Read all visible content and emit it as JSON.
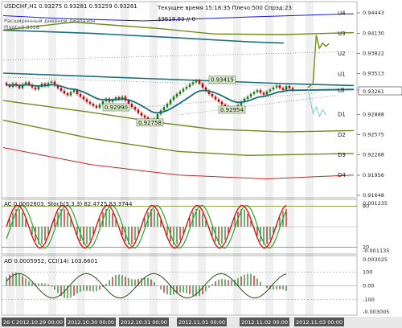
{
  "header": {
    "symbol_line": "USDCHF,H1  0.93275 0.93281 0.93259 0.93261",
    "subtitle_1": "Расширенный дневной диапазон",
    "subtitle_2": "Pivot=0.9318",
    "status": "Текущее время 15:18:35 Плечо:500 Спрэд:23",
    "balance": "$9618.93  // 0"
  },
  "price_axis": {
    "labels": [
      "0.94443",
      "0.94130",
      "0.93822",
      "0.93513",
      "0.93261",
      "0.92888",
      "0.92575",
      "0.92268",
      "0.91956",
      "0.91648"
    ],
    "current": "0.93261"
  },
  "ac_axis": {
    "labels": [
      "0.001235",
      "80",
      "20",
      "-0.001135"
    ]
  },
  "cci_axis": {
    "labels": [
      "0.003025",
      "100",
      "0.00",
      "-100",
      "-0.003005"
    ]
  },
  "ac_header": "AC 0.0002803, Stoch(5,3,3) 82.4725 83.3744",
  "cci_header": "AO 0.0005952, CCI(14) 103.6601",
  "date_labels": [
    "26 O",
    "2012.10.29 00:00",
    "2012.10.30 00:00",
    "2012.10.31 00:00",
    "2012.11.01 00:00",
    "2012.11.02 00:00",
    "2012.11.03 00:00"
  ],
  "levels": {
    "U4": "U4",
    "U3": "U3",
    "U2": "U2",
    "U1": "U1",
    "LB": "LB",
    "D1": "D1",
    "D2": "D2",
    "D3": "D3",
    "D4": "D4"
  },
  "annotations": {
    "low1": "0.92990",
    "low2": "0.92758",
    "high1": "0.93415",
    "low3": "0.92954"
  },
  "colors": {
    "bull": "#1a7a1a",
    "bear": "#cc0000",
    "band_olive": "#6e8a1a",
    "band_teal": "#1a6e7a",
    "band_blue": "#1a1acc",
    "band_red": "#cc2222",
    "stoch_green": "#2aa52a",
    "stoch_red": "#e01010"
  },
  "chart_data": {
    "type": "line",
    "title": "USDCHF,H1",
    "instrument": "USDCHF",
    "timeframe": "H1",
    "ohlc_last": {
      "open": 0.93275,
      "high": 0.93281,
      "low": 0.93259,
      "close": 0.93261
    },
    "pivot": 0.9318,
    "y_range": [
      0.91648,
      0.94443
    ],
    "annotated_points": [
      {
        "label": "0.92990",
        "value": 0.9299
      },
      {
        "label": "0.92758",
        "value": 0.92758
      },
      {
        "label": "0.93415",
        "value": 0.93415
      },
      {
        "label": "0.92954",
        "value": 0.92954
      }
    ],
    "close_series": [
      0.9334,
      0.9331,
      0.9336,
      0.9333,
      0.9329,
      0.9335,
      0.9338,
      0.9334,
      0.933,
      0.9327,
      0.9331,
      0.9336,
      0.9332,
      0.9337,
      0.9339,
      0.9333,
      0.9329,
      0.9325,
      0.9321,
      0.9318,
      0.9323,
      0.9326,
      0.932,
      0.9316,
      0.9312,
      0.9308,
      0.9305,
      0.9302,
      0.9299,
      0.9304,
      0.9309,
      0.9313,
      0.9308,
      0.9311,
      0.9315,
      0.9312,
      0.9316,
      0.931,
      0.9305,
      0.93,
      0.9296,
      0.9291,
      0.9287,
      0.9284,
      0.9279,
      0.9276,
      0.9282,
      0.9289,
      0.9295,
      0.93,
      0.9305,
      0.9311,
      0.9316,
      0.932,
      0.9324,
      0.9328,
      0.9331,
      0.9335,
      0.9338,
      0.9341,
      0.9336,
      0.933,
      0.9325,
      0.932,
      0.9316,
      0.9312,
      0.9308,
      0.9304,
      0.9301,
      0.9298,
      0.9295,
      0.9299,
      0.9303,
      0.9308,
      0.9313,
      0.9316,
      0.932,
      0.9323,
      0.9326,
      0.9322,
      0.9319,
      0.9324,
      0.9327,
      0.933,
      0.9333,
      0.9329,
      0.9326,
      0.9332,
      0.9329,
      0.9326
    ],
    "levels": [
      {
        "name": "U4",
        "value": 0.9444
      },
      {
        "name": "U3",
        "value": 0.9413
      },
      {
        "name": "U2",
        "value": 0.9382
      },
      {
        "name": "U1",
        "value": 0.9351
      },
      {
        "name": "LB",
        "value": 0.9326
      },
      {
        "name": "D1",
        "value": 0.9289
      },
      {
        "name": "D2",
        "value": 0.9258
      },
      {
        "name": "D3",
        "value": 0.9227
      },
      {
        "name": "D4",
        "value": 0.9196
      }
    ],
    "x_labels": [
      "2012.10.29 00:00",
      "2012.10.30 00:00",
      "2012.10.31 00:00",
      "2012.11.01 00:00",
      "2012.11.02 00:00",
      "2012.11.03 00:00"
    ],
    "stoch_levels": [
      80,
      20
    ],
    "cci_levels": [
      100,
      0,
      -100
    ]
  }
}
